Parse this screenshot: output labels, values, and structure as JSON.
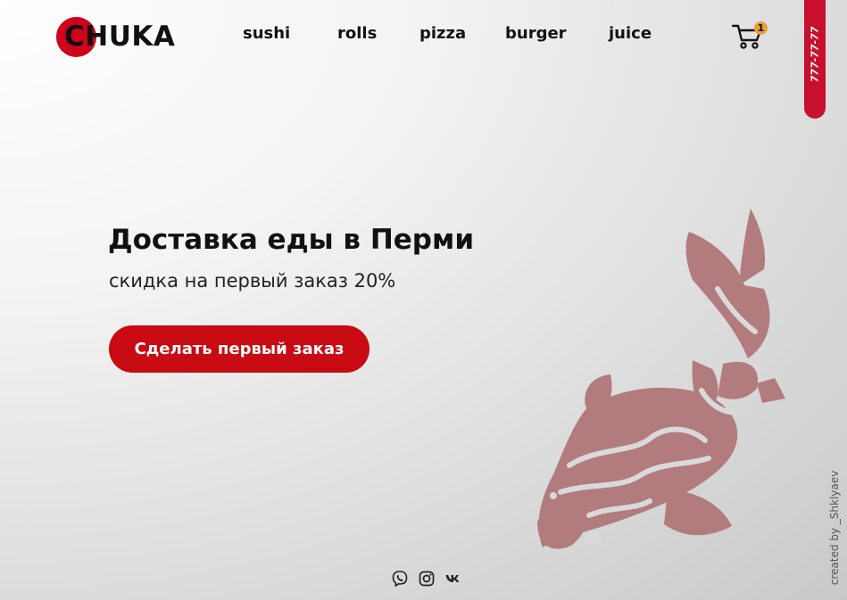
{
  "brand": {
    "logo_text": "CHUKA",
    "accent_color": "#d0021b"
  },
  "nav": {
    "items": [
      "sushi",
      "rolls",
      "pizza",
      "burger",
      "juice"
    ]
  },
  "cart": {
    "icon": "cart-icon",
    "count": "1",
    "badge_color": "#e8a13a"
  },
  "phone": {
    "number": "777-77-77"
  },
  "hero": {
    "title": "Доставка еды в Перми",
    "subtitle": "скидка на первый заказ 20%",
    "cta_label": "Сделать первый заказ",
    "cta_color": "#c80a12",
    "illustration": "koi-fish-icon",
    "illustration_color": "#b27b7e"
  },
  "socials": [
    "viber-icon",
    "instagram-icon",
    "vk-icon"
  ],
  "credit": "created by _Shklyaev"
}
